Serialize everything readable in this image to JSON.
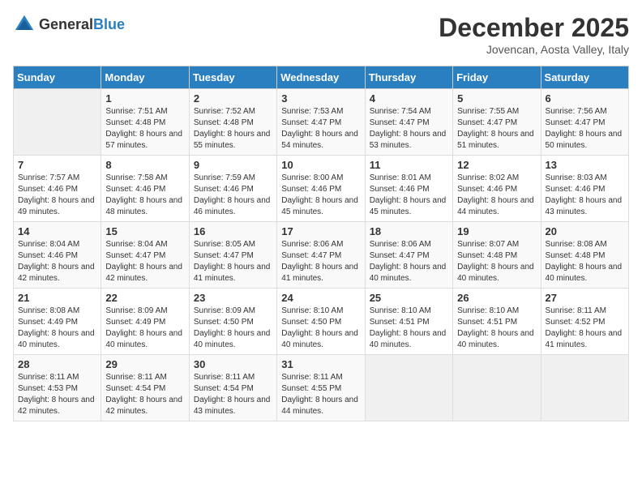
{
  "header": {
    "logo_general": "General",
    "logo_blue": "Blue",
    "month_title": "December 2025",
    "subtitle": "Jovencan, Aosta Valley, Italy"
  },
  "days_of_week": [
    "Sunday",
    "Monday",
    "Tuesday",
    "Wednesday",
    "Thursday",
    "Friday",
    "Saturday"
  ],
  "weeks": [
    [
      {
        "day": "",
        "sunrise": "",
        "sunset": "",
        "daylight": "",
        "empty": true
      },
      {
        "day": "1",
        "sunrise": "Sunrise: 7:51 AM",
        "sunset": "Sunset: 4:48 PM",
        "daylight": "Daylight: 8 hours and 57 minutes."
      },
      {
        "day": "2",
        "sunrise": "Sunrise: 7:52 AM",
        "sunset": "Sunset: 4:48 PM",
        "daylight": "Daylight: 8 hours and 55 minutes."
      },
      {
        "day": "3",
        "sunrise": "Sunrise: 7:53 AM",
        "sunset": "Sunset: 4:47 PM",
        "daylight": "Daylight: 8 hours and 54 minutes."
      },
      {
        "day": "4",
        "sunrise": "Sunrise: 7:54 AM",
        "sunset": "Sunset: 4:47 PM",
        "daylight": "Daylight: 8 hours and 53 minutes."
      },
      {
        "day": "5",
        "sunrise": "Sunrise: 7:55 AM",
        "sunset": "Sunset: 4:47 PM",
        "daylight": "Daylight: 8 hours and 51 minutes."
      },
      {
        "day": "6",
        "sunrise": "Sunrise: 7:56 AM",
        "sunset": "Sunset: 4:47 PM",
        "daylight": "Daylight: 8 hours and 50 minutes."
      }
    ],
    [
      {
        "day": "7",
        "sunrise": "Sunrise: 7:57 AM",
        "sunset": "Sunset: 4:46 PM",
        "daylight": "Daylight: 8 hours and 49 minutes."
      },
      {
        "day": "8",
        "sunrise": "Sunrise: 7:58 AM",
        "sunset": "Sunset: 4:46 PM",
        "daylight": "Daylight: 8 hours and 48 minutes."
      },
      {
        "day": "9",
        "sunrise": "Sunrise: 7:59 AM",
        "sunset": "Sunset: 4:46 PM",
        "daylight": "Daylight: 8 hours and 46 minutes."
      },
      {
        "day": "10",
        "sunrise": "Sunrise: 8:00 AM",
        "sunset": "Sunset: 4:46 PM",
        "daylight": "Daylight: 8 hours and 45 minutes."
      },
      {
        "day": "11",
        "sunrise": "Sunrise: 8:01 AM",
        "sunset": "Sunset: 4:46 PM",
        "daylight": "Daylight: 8 hours and 45 minutes."
      },
      {
        "day": "12",
        "sunrise": "Sunrise: 8:02 AM",
        "sunset": "Sunset: 4:46 PM",
        "daylight": "Daylight: 8 hours and 44 minutes."
      },
      {
        "day": "13",
        "sunrise": "Sunrise: 8:03 AM",
        "sunset": "Sunset: 4:46 PM",
        "daylight": "Daylight: 8 hours and 43 minutes."
      }
    ],
    [
      {
        "day": "14",
        "sunrise": "Sunrise: 8:04 AM",
        "sunset": "Sunset: 4:46 PM",
        "daylight": "Daylight: 8 hours and 42 minutes."
      },
      {
        "day": "15",
        "sunrise": "Sunrise: 8:04 AM",
        "sunset": "Sunset: 4:47 PM",
        "daylight": "Daylight: 8 hours and 42 minutes."
      },
      {
        "day": "16",
        "sunrise": "Sunrise: 8:05 AM",
        "sunset": "Sunset: 4:47 PM",
        "daylight": "Daylight: 8 hours and 41 minutes."
      },
      {
        "day": "17",
        "sunrise": "Sunrise: 8:06 AM",
        "sunset": "Sunset: 4:47 PM",
        "daylight": "Daylight: 8 hours and 41 minutes."
      },
      {
        "day": "18",
        "sunrise": "Sunrise: 8:06 AM",
        "sunset": "Sunset: 4:47 PM",
        "daylight": "Daylight: 8 hours and 40 minutes."
      },
      {
        "day": "19",
        "sunrise": "Sunrise: 8:07 AM",
        "sunset": "Sunset: 4:48 PM",
        "daylight": "Daylight: 8 hours and 40 minutes."
      },
      {
        "day": "20",
        "sunrise": "Sunrise: 8:08 AM",
        "sunset": "Sunset: 4:48 PM",
        "daylight": "Daylight: 8 hours and 40 minutes."
      }
    ],
    [
      {
        "day": "21",
        "sunrise": "Sunrise: 8:08 AM",
        "sunset": "Sunset: 4:49 PM",
        "daylight": "Daylight: 8 hours and 40 minutes."
      },
      {
        "day": "22",
        "sunrise": "Sunrise: 8:09 AM",
        "sunset": "Sunset: 4:49 PM",
        "daylight": "Daylight: 8 hours and 40 minutes."
      },
      {
        "day": "23",
        "sunrise": "Sunrise: 8:09 AM",
        "sunset": "Sunset: 4:50 PM",
        "daylight": "Daylight: 8 hours and 40 minutes."
      },
      {
        "day": "24",
        "sunrise": "Sunrise: 8:10 AM",
        "sunset": "Sunset: 4:50 PM",
        "daylight": "Daylight: 8 hours and 40 minutes."
      },
      {
        "day": "25",
        "sunrise": "Sunrise: 8:10 AM",
        "sunset": "Sunset: 4:51 PM",
        "daylight": "Daylight: 8 hours and 40 minutes."
      },
      {
        "day": "26",
        "sunrise": "Sunrise: 8:10 AM",
        "sunset": "Sunset: 4:51 PM",
        "daylight": "Daylight: 8 hours and 40 minutes."
      },
      {
        "day": "27",
        "sunrise": "Sunrise: 8:11 AM",
        "sunset": "Sunset: 4:52 PM",
        "daylight": "Daylight: 8 hours and 41 minutes."
      }
    ],
    [
      {
        "day": "28",
        "sunrise": "Sunrise: 8:11 AM",
        "sunset": "Sunset: 4:53 PM",
        "daylight": "Daylight: 8 hours and 42 minutes."
      },
      {
        "day": "29",
        "sunrise": "Sunrise: 8:11 AM",
        "sunset": "Sunset: 4:54 PM",
        "daylight": "Daylight: 8 hours and 42 minutes."
      },
      {
        "day": "30",
        "sunrise": "Sunrise: 8:11 AM",
        "sunset": "Sunset: 4:54 PM",
        "daylight": "Daylight: 8 hours and 43 minutes."
      },
      {
        "day": "31",
        "sunrise": "Sunrise: 8:11 AM",
        "sunset": "Sunset: 4:55 PM",
        "daylight": "Daylight: 8 hours and 44 minutes."
      },
      {
        "day": "",
        "sunrise": "",
        "sunset": "",
        "daylight": "",
        "empty": true
      },
      {
        "day": "",
        "sunrise": "",
        "sunset": "",
        "daylight": "",
        "empty": true
      },
      {
        "day": "",
        "sunrise": "",
        "sunset": "",
        "daylight": "",
        "empty": true
      }
    ]
  ]
}
